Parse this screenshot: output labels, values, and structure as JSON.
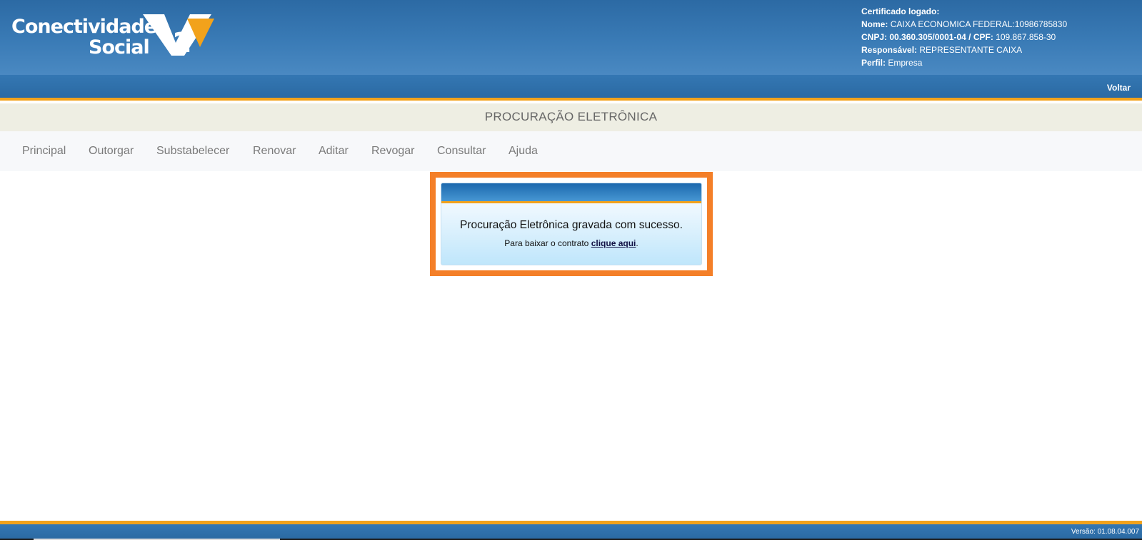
{
  "header": {
    "logo": {
      "line1": "Conectividade",
      "line2": "Social",
      "version_mark": "2"
    },
    "certificate": {
      "heading": "Certificado logado:",
      "nome_label": "Nome:",
      "nome_value": "CAIXA ECONOMICA FEDERAL:10986785830",
      "cnpj_label": "CNPJ:",
      "cnpj_value": "00.360.305/0001-04",
      "cpf_label": "CPF:",
      "cpf_value": "109.867.858-30",
      "cpf_separator": " / ",
      "responsavel_label": "Responsável:",
      "responsavel_value": "REPRESENTANTE CAIXA",
      "perfil_label": "Perfil:",
      "perfil_value": "Empresa"
    },
    "colors": {
      "primary": "#2c6aa4",
      "accent": "#f2a21b",
      "highlight": "#f47f28"
    }
  },
  "navbar": {
    "back_label": "Voltar"
  },
  "page_title": "PROCURAÇÃO ELETRÔNICA",
  "menu": {
    "items": [
      {
        "label": "Principal"
      },
      {
        "label": "Outorgar"
      },
      {
        "label": "Substabelecer"
      },
      {
        "label": "Renovar"
      },
      {
        "label": "Aditar"
      },
      {
        "label": "Revogar"
      },
      {
        "label": "Consultar"
      },
      {
        "label": "Ajuda"
      }
    ]
  },
  "message": {
    "title": "Procuração Eletrônica gravada com sucesso.",
    "sub_prefix": "Para baixar o contrato ",
    "link_label": "clique aqui",
    "sub_suffix": "."
  },
  "footer": {
    "version": "Versão: 01.08.04.007"
  }
}
